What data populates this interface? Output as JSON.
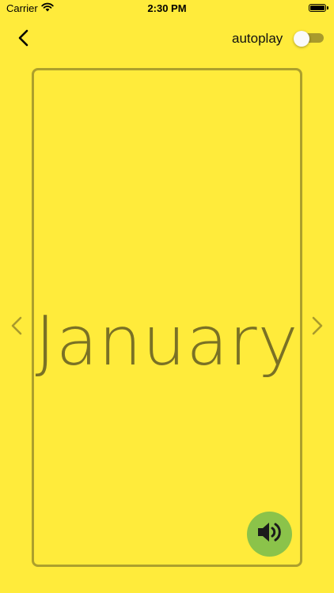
{
  "status_bar": {
    "carrier": "Carrier",
    "time": "2:30 PM"
  },
  "header": {
    "autoplay_label": "autoplay",
    "autoplay_on": false
  },
  "card": {
    "word": "January"
  },
  "colors": {
    "background": "#FFEB3B",
    "card_border": "#ADA02C",
    "word_text": "#7A7125",
    "nav_arrow": "#A99A2C",
    "speaker_button": "#8BC34A"
  },
  "icons": {
    "back": "chevron-left-icon",
    "prev": "chevron-left-icon",
    "next": "chevron-right-icon",
    "speaker": "speaker-icon",
    "wifi": "wifi-icon",
    "battery": "battery-icon"
  }
}
